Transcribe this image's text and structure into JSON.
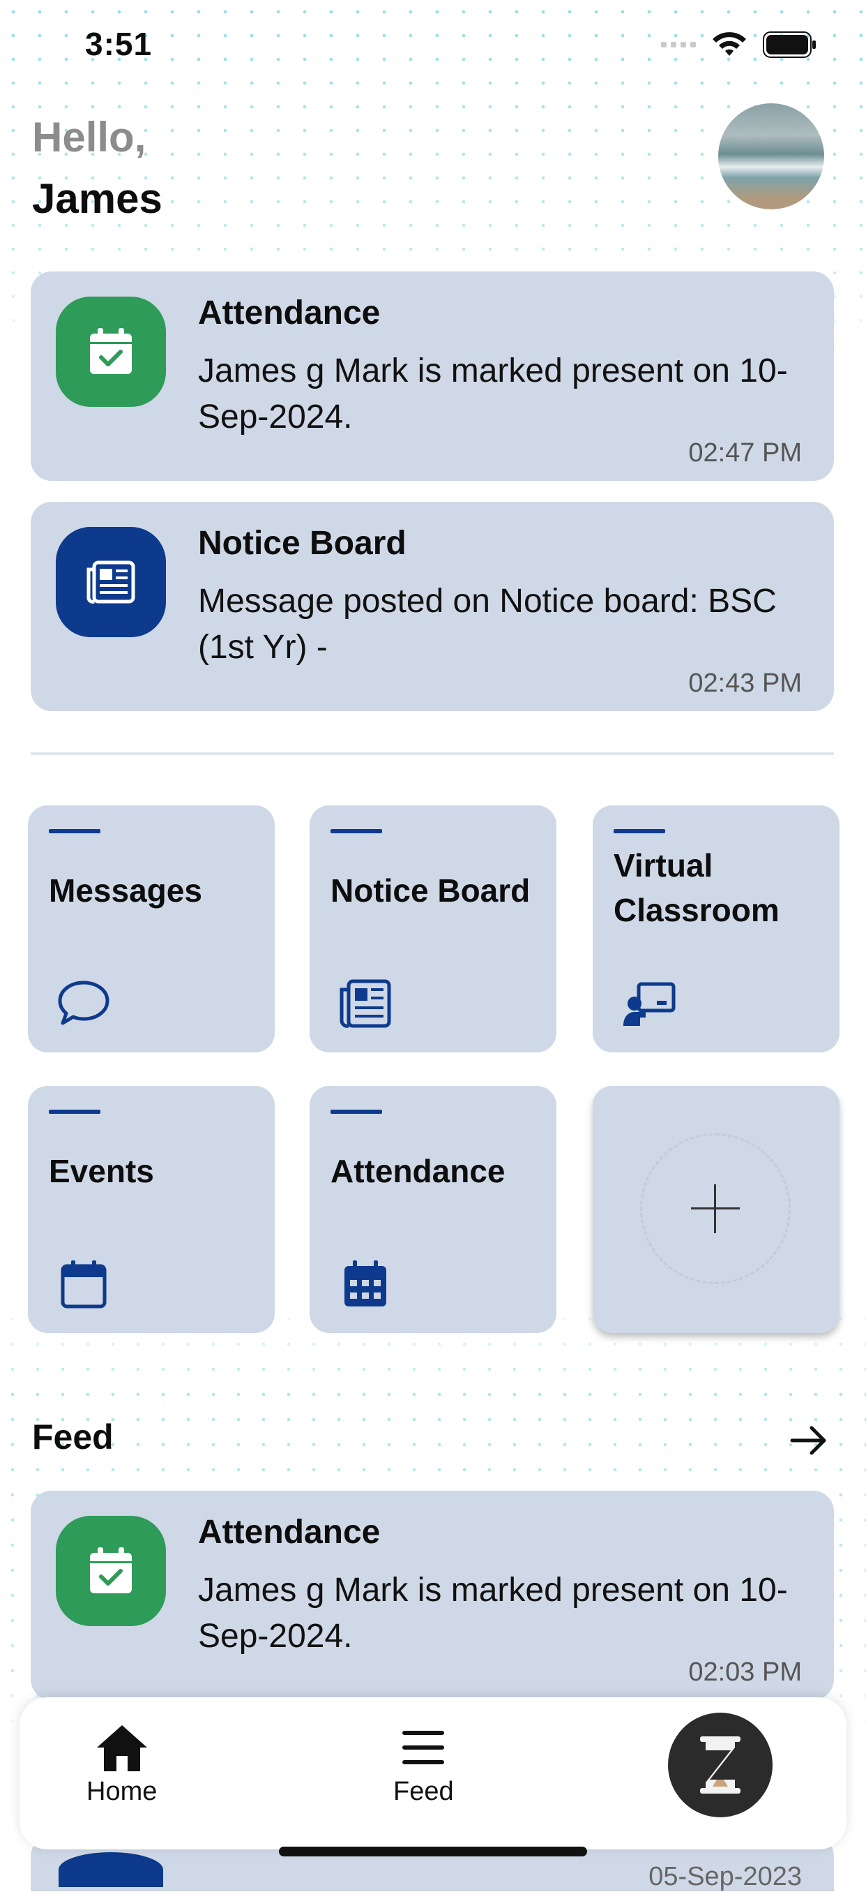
{
  "status": {
    "time": "3:51"
  },
  "greeting": {
    "hello": "Hello,",
    "name": "James"
  },
  "notifications": [
    {
      "title": "Attendance",
      "message": "James g  Mark is marked present on 10-Sep-2024.",
      "time": "02:47 PM",
      "icon": "calendar-check-icon",
      "color": "#2e9b58"
    },
    {
      "title": "Notice Board",
      "message": "Message posted on Notice board: BSC (1st Yr) -",
      "time": "02:43 PM",
      "icon": "newspaper-icon",
      "color": "#0d3a8c"
    }
  ],
  "tiles": [
    {
      "label": "Messages",
      "icon": "chat-bubble-icon"
    },
    {
      "label": "Notice Board",
      "icon": "newspaper-icon"
    },
    {
      "label": "Virtual Classroom",
      "icon": "teacher-board-icon"
    },
    {
      "label": "Events",
      "icon": "calendar-icon"
    },
    {
      "label": "Attendance",
      "icon": "calendar-grid-icon"
    },
    {
      "label": "",
      "icon": "plus-icon"
    }
  ],
  "feed": {
    "title": "Feed",
    "items": [
      {
        "title": "Attendance",
        "message": "James g  Mark is marked present on 10-Sep-2024.",
        "time": "02:03 PM",
        "icon": "calendar-check-icon"
      }
    ],
    "partial_time": "05-Sep-2023"
  },
  "nav": {
    "home": "Home",
    "feed": "Feed"
  },
  "colors": {
    "card": "#cfd8e6",
    "primary": "#0d3a8c",
    "success": "#2e9b58",
    "accent_dots": "#22b8cf"
  }
}
